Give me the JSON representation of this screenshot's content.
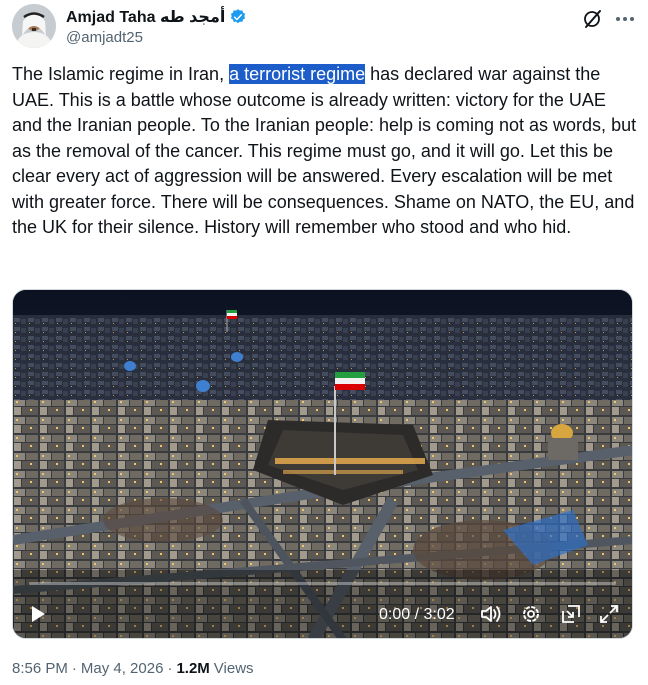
{
  "author": {
    "display_name": "Amjad Taha أمجد طه",
    "handle": "@amjadt25",
    "verified_color": "#1d9bf0"
  },
  "tweet": {
    "text_before": "The Islamic regime in Iran, ",
    "highlighted": "a terrorist regime",
    "text_after": " has declared war against the UAE. This is a battle whose outcome is already written: victory for the UAE and the Iranian people. To the Iranian people: help is coming not as words, but as the removal of the cancer. This regime must go, and it will go. Let this be clear every act of aggression will be answered. Every escalation will be met with greater force. There will be consequences. Shame on NATO, the EU, and the UK for their silence. History will remember who stood and who hid."
  },
  "video": {
    "current_time": "0:00",
    "separator": " / ",
    "duration": "3:02",
    "progress_fraction": 0.0,
    "icons": [
      "play-icon",
      "volume-icon",
      "settings-icon",
      "pip-icon",
      "fullscreen-icon"
    ]
  },
  "meta": {
    "time": "8:56 PM",
    "dot1": "·",
    "date": "May 4, 2026",
    "dot2": "·",
    "views_count": "1.2M",
    "views_label": "Views"
  },
  "colors": {
    "text": "#0f1419",
    "secondary": "#536471",
    "highlight": "#1d5dc9",
    "verified": "#1d9bf0"
  }
}
